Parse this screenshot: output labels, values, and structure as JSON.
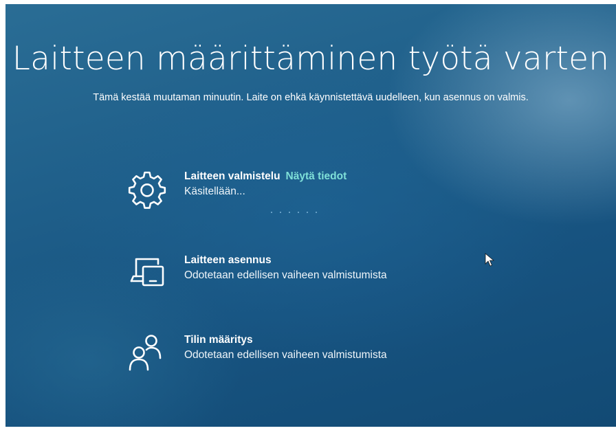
{
  "header": {
    "title": "Laitteen määrittäminen työtä varten",
    "subtitle": "Tämä kestää muutaman minuutin. Laite on ehkä käynnistettävä uudelleen, kun asennus on valmis."
  },
  "steps": [
    {
      "icon": "gear-icon",
      "name": "Laitteen valmistelu",
      "link": "Näytä tiedot",
      "status": "Käsitellään..."
    },
    {
      "icon": "devices-icon",
      "name": "Laitteen asennus",
      "status": "Odotetaan edellisen vaiheen valmistumista"
    },
    {
      "icon": "people-icon",
      "name": "Tilin määritys",
      "status": "Odotetaan edellisen vaiheen valmistumista"
    }
  ],
  "colors": {
    "background": "#1f5f8a",
    "text": "#ffffff",
    "link": "#7fe0d8"
  }
}
